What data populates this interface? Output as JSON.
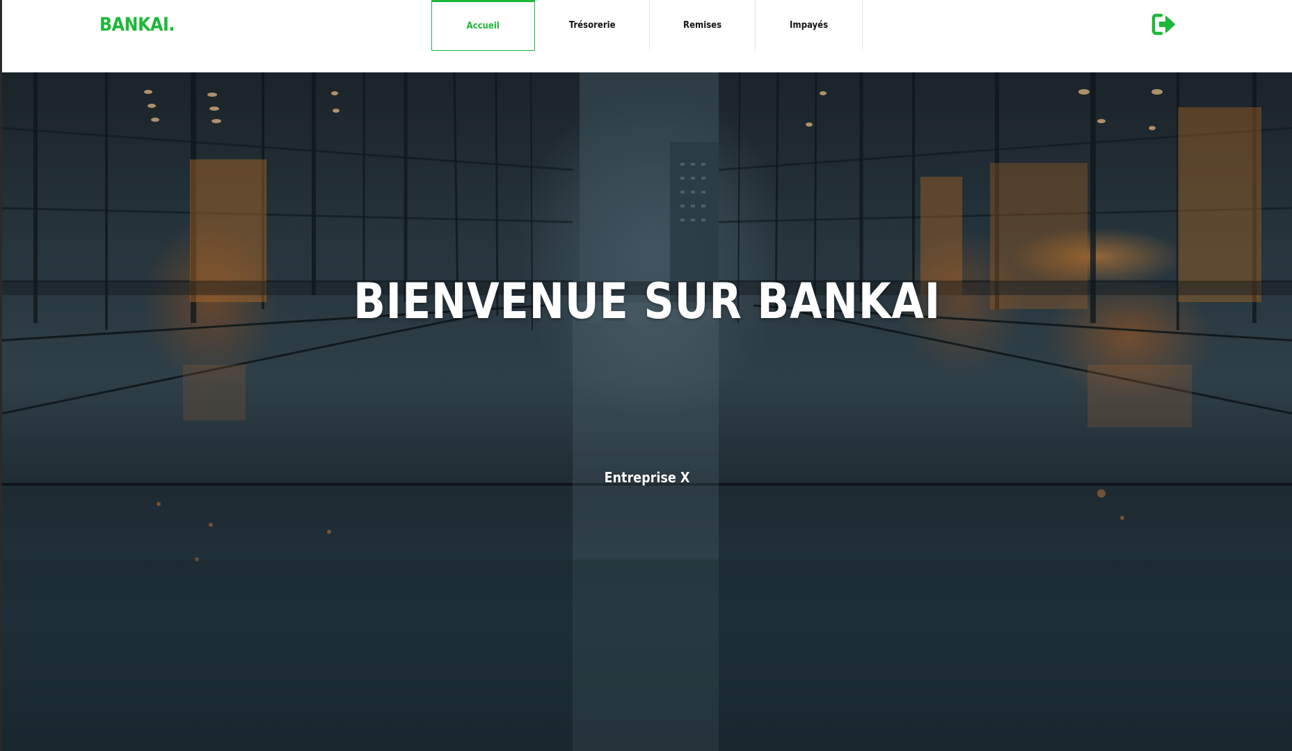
{
  "header": {
    "logo": "BANKAI.",
    "tabs": [
      {
        "label": "Accueil",
        "active": true
      },
      {
        "label": "Trésorerie",
        "active": false
      },
      {
        "label": "Remises",
        "active": false
      },
      {
        "label": "Impayés",
        "active": false
      }
    ],
    "logout_icon": "sign-out-icon"
  },
  "hero": {
    "title": "BIENVENUE SUR BANKAI",
    "subtitle": "Entreprise X",
    "background": "glass-corridor-photo"
  },
  "colors": {
    "accent": "#1db83a",
    "nav_text": "#111111",
    "hero_text": "#ffffff"
  }
}
